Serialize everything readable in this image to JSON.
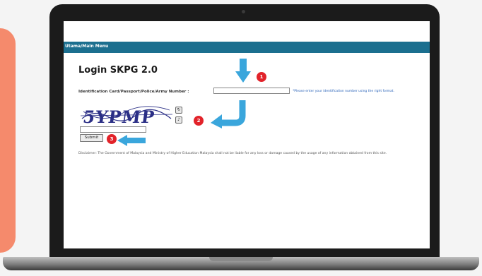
{
  "nav": {
    "link": "Utama/Main Menu"
  },
  "login": {
    "title": "Login SKPG 2.0",
    "id_label": "Identification Card/Passport/Police/Army Number :",
    "id_value": "",
    "id_hint": "*Please enter your identification number using the right format.",
    "captcha_text": "5YPMP",
    "captcha_refresh_icon": "refresh-icon",
    "captcha_audio_icon": "audio-icon",
    "captcha_value": "",
    "submit_label": "Submit",
    "disclaimer": "Disclaimer: The Government of Malaysia and Ministry of Higher Education Malaysia shall not be liable for any loss or damage caused by the usage of any information obtained from this site."
  },
  "annotations": {
    "step_1": "1",
    "step_2": "2",
    "step_3": "3",
    "arrow_color": "#3aa6dc",
    "badge_color": "#e2232a"
  },
  "colors": {
    "accent_panel": "#f58a6c",
    "nav_bar": "#1b6f8f",
    "laptop_bezel": "#1b1b1b"
  }
}
